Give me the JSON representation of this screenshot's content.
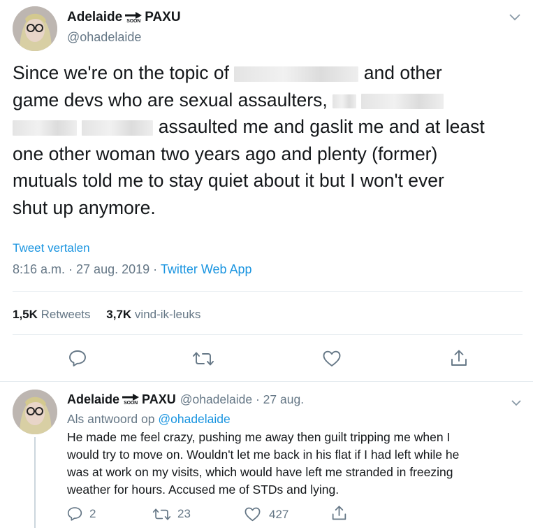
{
  "tweet": {
    "display_name": "Adelaide",
    "name_suffix": "PAXU",
    "soon_badge": "SOON",
    "handle": "@ohadelaide",
    "text_lines": [
      "Since we're on the topic of",
      "and other",
      "game devs who are sexual assaulters,",
      "assaulted me and gaslit me and at least",
      "one other woman two years ago and plenty (former)",
      "mutuals told me to stay quiet about it but I won't ever",
      "shut up anymore."
    ],
    "translate_label": "Tweet vertalen",
    "timestamp": "8:16 a.m. · 27 aug. 2019",
    "separator": " · ",
    "source": "Twitter Web App",
    "retweets_count": "1,5K",
    "retweets_label": "Retweets",
    "likes_count": "3,7K",
    "likes_label": "vind-ik-leuks",
    "actions": [
      "reply-icon",
      "retweet-icon",
      "like-icon",
      "share-icon"
    ]
  },
  "reply": {
    "display_name": "Adelaide",
    "name_suffix": "PAXU",
    "soon_badge": "SOON",
    "handle_date": "@ohadelaide · 27 aug.",
    "in_reply_prefix": "Als antwoord op ",
    "in_reply_handle": "@ohadelaide",
    "text_lines": [
      "He made me feel crazy, pushing me away then guilt tripping me when I",
      "would try to move on. Wouldn't let me back in his flat if I had left while he",
      "was at work on my visits, which would have left me stranded in freezing",
      "weather for hours. Accused me of STDs and lying."
    ],
    "reply_count": "2",
    "retweet_count": "23",
    "like_count": "427"
  },
  "colors": {
    "text": "#14171a",
    "secondary": "#657786",
    "link": "#1b95e0",
    "divider": "#e6ecf0",
    "icon": "#657786"
  }
}
